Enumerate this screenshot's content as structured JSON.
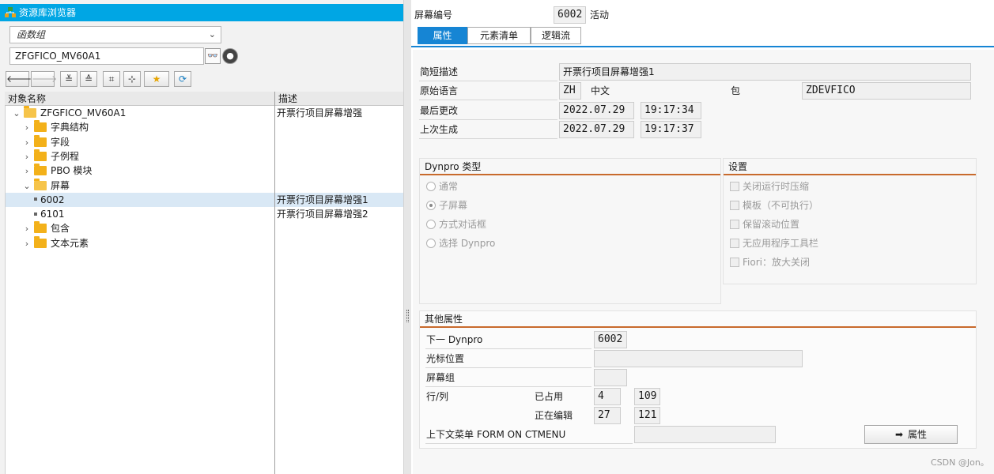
{
  "repo": {
    "title": "资源库浏览器",
    "object_type": "函数组",
    "object_name": "ZFGFICO_MV60A1",
    "toolbar_icons": [
      "back-arrow-icon",
      "forward-arrow-icon",
      "expand-all-icon",
      "collapse-all-icon",
      "binoculars-icon",
      "hierarchy-icon",
      "favorites-star-icon",
      "refresh-icon"
    ],
    "col_name": "对象名称",
    "col_desc": "描述",
    "tree": [
      {
        "name": "ZFGFICO_MV60A1",
        "desc": "开票行项目屏幕增强",
        "level": 0,
        "type": "folder-open",
        "expanded": true
      },
      {
        "name": "字典结构",
        "desc": "",
        "level": 1,
        "type": "folder"
      },
      {
        "name": "字段",
        "desc": "",
        "level": 1,
        "type": "folder"
      },
      {
        "name": "子例程",
        "desc": "",
        "level": 1,
        "type": "folder"
      },
      {
        "name": "PBO 模块",
        "desc": "",
        "level": 1,
        "type": "folder"
      },
      {
        "name": "屏幕",
        "desc": "",
        "level": 1,
        "type": "folder-open",
        "expanded": true
      },
      {
        "name": "6002",
        "desc": "开票行项目屏幕增强1",
        "level": 2,
        "type": "leaf",
        "selected": true
      },
      {
        "name": "6101",
        "desc": "开票行项目屏幕增强2",
        "level": 2,
        "type": "leaf"
      },
      {
        "name": "包含",
        "desc": "",
        "level": 1,
        "type": "folder"
      },
      {
        "name": "文本元素",
        "desc": "",
        "level": 1,
        "type": "folder"
      }
    ]
  },
  "screen": {
    "number_label": "屏幕编号",
    "number": "6002",
    "status": "活动",
    "tabs": [
      "属性",
      "元素清单",
      "逻辑流"
    ],
    "active_tab": 0,
    "short_desc_label": "简短描述",
    "short_desc": "开票行项目屏幕增强1",
    "orig_lang_label": "原始语言",
    "orig_lang_code": "ZH",
    "orig_lang_name": "中文",
    "package_label": "包",
    "package": "ZDEVFICO",
    "last_changed_label": "最后更改",
    "last_changed_date": "2022.07.29",
    "last_changed_time": "19:17:34",
    "last_gen_label": "上次生成",
    "last_gen_date": "2022.07.29",
    "last_gen_time": "19:17:37"
  },
  "dynpro_type": {
    "title": "Dynpro 类型",
    "options": [
      "通常",
      "子屏幕",
      "方式对话框",
      "选择 Dynpro"
    ],
    "selected": 1
  },
  "settings": {
    "title": "设置",
    "options": [
      "关闭运行时压缩",
      "模板（不可执行）",
      "保留滚动位置",
      "无应用程序工具栏",
      "Fiori：放大关闭"
    ]
  },
  "other": {
    "title": "其他属性",
    "next_dynpro_label": "下一 Dynpro",
    "next_dynpro": "6002",
    "cursor_label": "光标位置",
    "screen_group_label": "屏幕组",
    "rowcol_label": "行/列",
    "used_label": "已占用",
    "used_row": "4",
    "used_col": "109",
    "editing_label": "正在编辑",
    "edit_row": "27",
    "edit_col": "121",
    "context_menu_label": "上下文菜单 FORM ON CTMENU",
    "attr_button": "属性"
  },
  "watermark": "CSDN @Jon。",
  "colors": {
    "title_bar": "#00a6e4",
    "tab_active": "#1685d4",
    "group_bar": "#c86a2c"
  }
}
